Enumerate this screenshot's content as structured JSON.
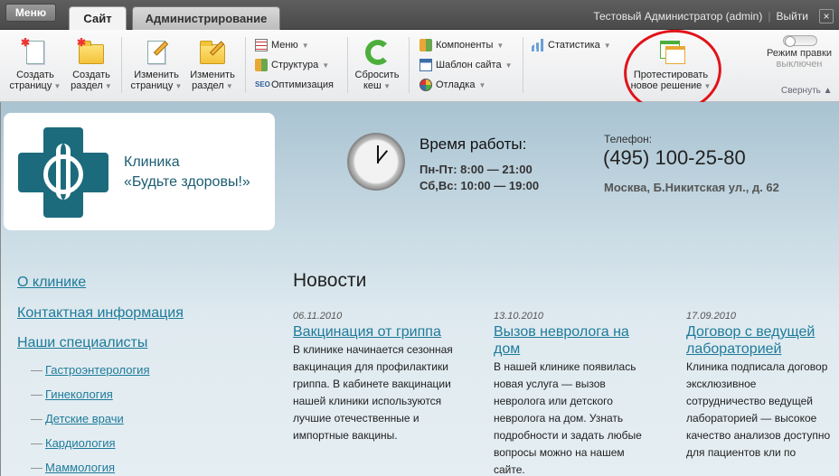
{
  "topbar": {
    "menu_label": "Меню",
    "tabs": [
      {
        "label": "Сайт",
        "active": true
      },
      {
        "label": "Администрирование",
        "active": false
      }
    ],
    "user": "Тестовый Администратор (admin)",
    "logout": "Выйти",
    "close_icon": "close-icon"
  },
  "toolbar": {
    "create_page": [
      "Создать",
      "страницу"
    ],
    "create_section": [
      "Создать",
      "раздел"
    ],
    "edit_page": [
      "Изменить",
      "страницу"
    ],
    "edit_section": [
      "Изменить",
      "раздел"
    ],
    "menu": "Меню",
    "structure": "Структура",
    "optimization": "Оптимизация",
    "clear_cache": [
      "Сбросить",
      "кеш"
    ],
    "components": "Компоненты",
    "site_template": "Шаблон сайта",
    "debug": "Отладка",
    "statistics": "Статистика",
    "test_solution": [
      "Протестировать",
      "новое решение"
    ],
    "edit_mode_label": "Режим правки",
    "edit_mode_state": "выключен",
    "collapse": "Свернуть"
  },
  "header": {
    "clinic_line1": "Клиника",
    "clinic_line2": "«Будьте здоровы!»",
    "work_title": "Время работы:",
    "hours": [
      "Пн-Пт: 8:00 — 21:00",
      "Сб,Вс: 10:00 — 19:00"
    ],
    "phone_label": "Телефон:",
    "phone": "(495) 100-25-80",
    "address": "Москва, Б.Никитская ул., д. 62"
  },
  "sidebar": {
    "links": [
      "О клинике",
      "Контактная информация",
      "Наши специалисты"
    ],
    "sublinks": [
      "Гастроэнтерология",
      "Гинекология",
      "Детские врачи",
      "Кардиология",
      "Маммология"
    ]
  },
  "news": {
    "title": "Новости",
    "items": [
      {
        "date": "06.11.2010",
        "title": "Вакцинация от гриппа",
        "text": "В клинике начинается сезонная вакцинация для профилактики гриппа. В кабинете вакцинации нашей клиники используются лучшие отечественные и импортные вакцины."
      },
      {
        "date": "13.10.2010",
        "title": "Вызов невролога на дом",
        "text": "В нашей клинике появилась новая услуга — вызов невролога или детского невролога на дом. Узнать подробности и задать любые вопросы можно на нашем сайте."
      },
      {
        "date": "17.09.2010",
        "title": "Договор с ведущей лабораторией",
        "text": "Клиника подписала договор эксклюзивное сотрудничество ведущей лабораторией — высокое качество анализов доступно для пациентов кли по умеренным ценам!"
      }
    ]
  }
}
